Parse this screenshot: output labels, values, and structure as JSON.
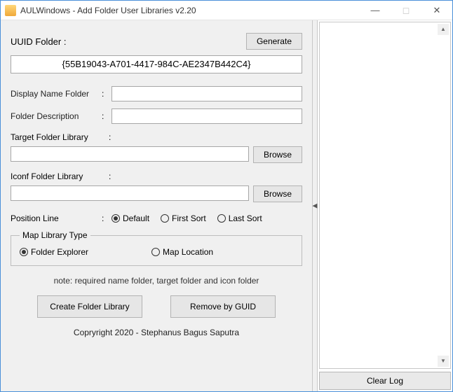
{
  "window": {
    "title": "AULWindows - Add Folder User Libraries v2.20"
  },
  "uuid": {
    "label": "UUID Folder  :",
    "generate_btn": "Generate",
    "value": "{55B19043-A701-4417-984C-AE2347B442C4}"
  },
  "display_name": {
    "label": "Display Name Folder",
    "value": ""
  },
  "folder_desc": {
    "label": "Folder Description",
    "value": ""
  },
  "target_lib": {
    "label": "Target Folder Library",
    "value": "",
    "browse": "Browse"
  },
  "iconf_lib": {
    "label": "Iconf Folder Library",
    "value": "",
    "browse": "Browse"
  },
  "position": {
    "label": "Position Line",
    "options": [
      "Default",
      "First Sort",
      "Last Sort"
    ],
    "selected": 0
  },
  "map_type": {
    "legend": "Map Library Type",
    "options": [
      "Folder Explorer",
      "Map Location"
    ],
    "selected": 0
  },
  "note": "note: required name folder, target folder and  icon folder",
  "actions": {
    "create": "Create Folder Library",
    "remove": "Remove by GUID"
  },
  "copyright": "Copryright 2020 - Stephanus Bagus Saputra",
  "log": {
    "clear_btn": "Clear Log"
  }
}
